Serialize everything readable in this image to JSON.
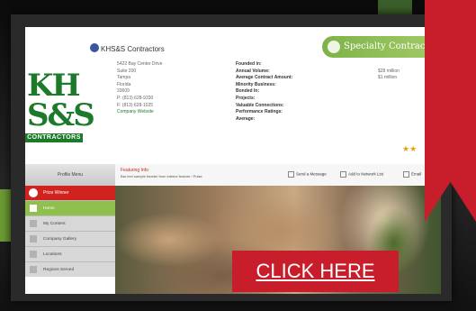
{
  "company": {
    "name": "KHS&S Contractors",
    "logo_text_1": "KH",
    "logo_text_2": "S&S",
    "logo_band": "CONTRACTORS",
    "address_lines": [
      "5422 Bay Center Drive",
      "Suite 200",
      "Tampa",
      "Florida",
      "33609",
      "P: (813) 628-9330",
      "F: (813) 628-1025"
    ],
    "link_label": "Company Website"
  },
  "profile_fields": [
    "Founded in:",
    "Annual Volume:",
    "Average Contract Amount:",
    "Minority Business:",
    "Bonded In:",
    "Projects:",
    "Valuable Connections:",
    "Performance Ratings:",
    "Average:"
  ],
  "profile_values": [
    "$28 million",
    "$1 million"
  ],
  "specialty_pill": {
    "label": "Specialty Contract"
  },
  "rating_stars": "★★",
  "sidebar": {
    "top_label": "Profile Menu",
    "highlight": "Prize Winner",
    "items": [
      {
        "label": "Home",
        "active": true
      },
      {
        "label": "My Content",
        "active": false
      },
      {
        "label": "Company Gallery",
        "active": false
      },
      {
        "label": "Locations",
        "active": false
      },
      {
        "label": "Regions Served",
        "active": false
      }
    ]
  },
  "content": {
    "title": "Featuring Info",
    "subtitle": "Bar text sample header from interior feature / Pulse",
    "controls": [
      "Send a Message",
      "Add to Network List",
      "Email"
    ]
  },
  "cta": {
    "label": "CLICK HERE"
  },
  "colors": {
    "brand_green": "#1d7a2a",
    "accent_red": "#c81d2a"
  }
}
